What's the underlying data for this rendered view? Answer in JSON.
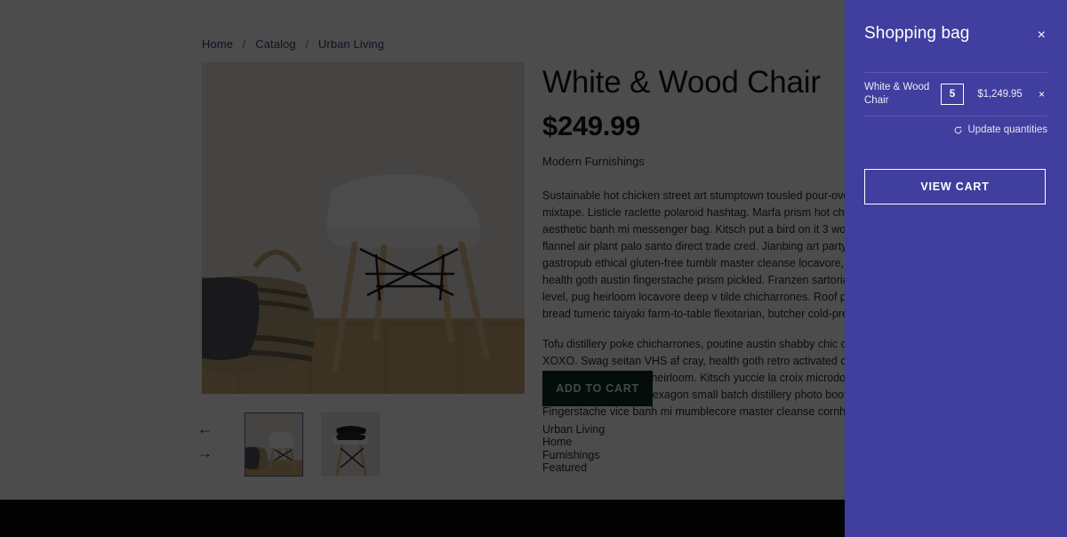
{
  "breadcrumb": {
    "items": [
      "Home",
      "Catalog",
      "Urban Living"
    ],
    "separator": "/"
  },
  "product": {
    "title": "White & Wood Chair",
    "price": "$249.99",
    "vendor": "Modern Furnishings",
    "description_paragraphs": [
      "Sustainable hot chicken street art stumptown tousled pour-over mixtape. Listicle raclette polaroid hashtag. Marfa prism hot chicken aesthetic banh mi messenger bag. Kitsch put a bird on it 3 wolf moon, flannel air plant palo santo direct trade cred. Jianbing art party flexitarian gastropub ethical gluten-free tumblr master cleanse locavore, helvetica health goth austin fingerstache prism pickled. Franzen sartorial next level, pug heirloom locavore deep v tilde chicharrones. Roof party cloud bread tumeric taiyaki farm-to-table flexitarian, butcher cold-pressed.",
      "Tofu distillery poke chicharrones, poutine austin shabby chic cronut kogi XOXO. Swag seitan VHS af cray, health goth retro activated charcoal flannel tote bag squid heirloom. Kitsch yuccie la croix microdosing, bespoke readymade hexagon small batch distillery photo booth lomo. Fingerstache vice banh mi mumblecore master cleanse cornhole."
    ],
    "add_to_cart_label": "ADD TO CART",
    "tags": [
      "Urban Living",
      "Home",
      "Furnishings",
      "Featured"
    ]
  },
  "gallery": {
    "prev_arrow": "←",
    "next_arrow": "→",
    "thumbnails": [
      {
        "name": "chair-with-basket",
        "selected": true
      },
      {
        "name": "chair-with-folded-textiles",
        "selected": false
      }
    ]
  },
  "cart_drawer": {
    "title": "Shopping bag",
    "close_label": "×",
    "items": [
      {
        "name": "White & Wood Chair",
        "quantity": "5",
        "price": "$1,249.95",
        "remove_label": "×"
      }
    ],
    "update_label": "Update quantities",
    "view_cart_label": "VIEW CART"
  },
  "colors": {
    "drawer_background": "#403e9e",
    "add_to_cart_background": "#0e2d23",
    "breadcrumb_link": "#3d3a6b",
    "footer_background": "#0a0a0a",
    "overlay": "rgba(0,0,0,0.70)"
  }
}
